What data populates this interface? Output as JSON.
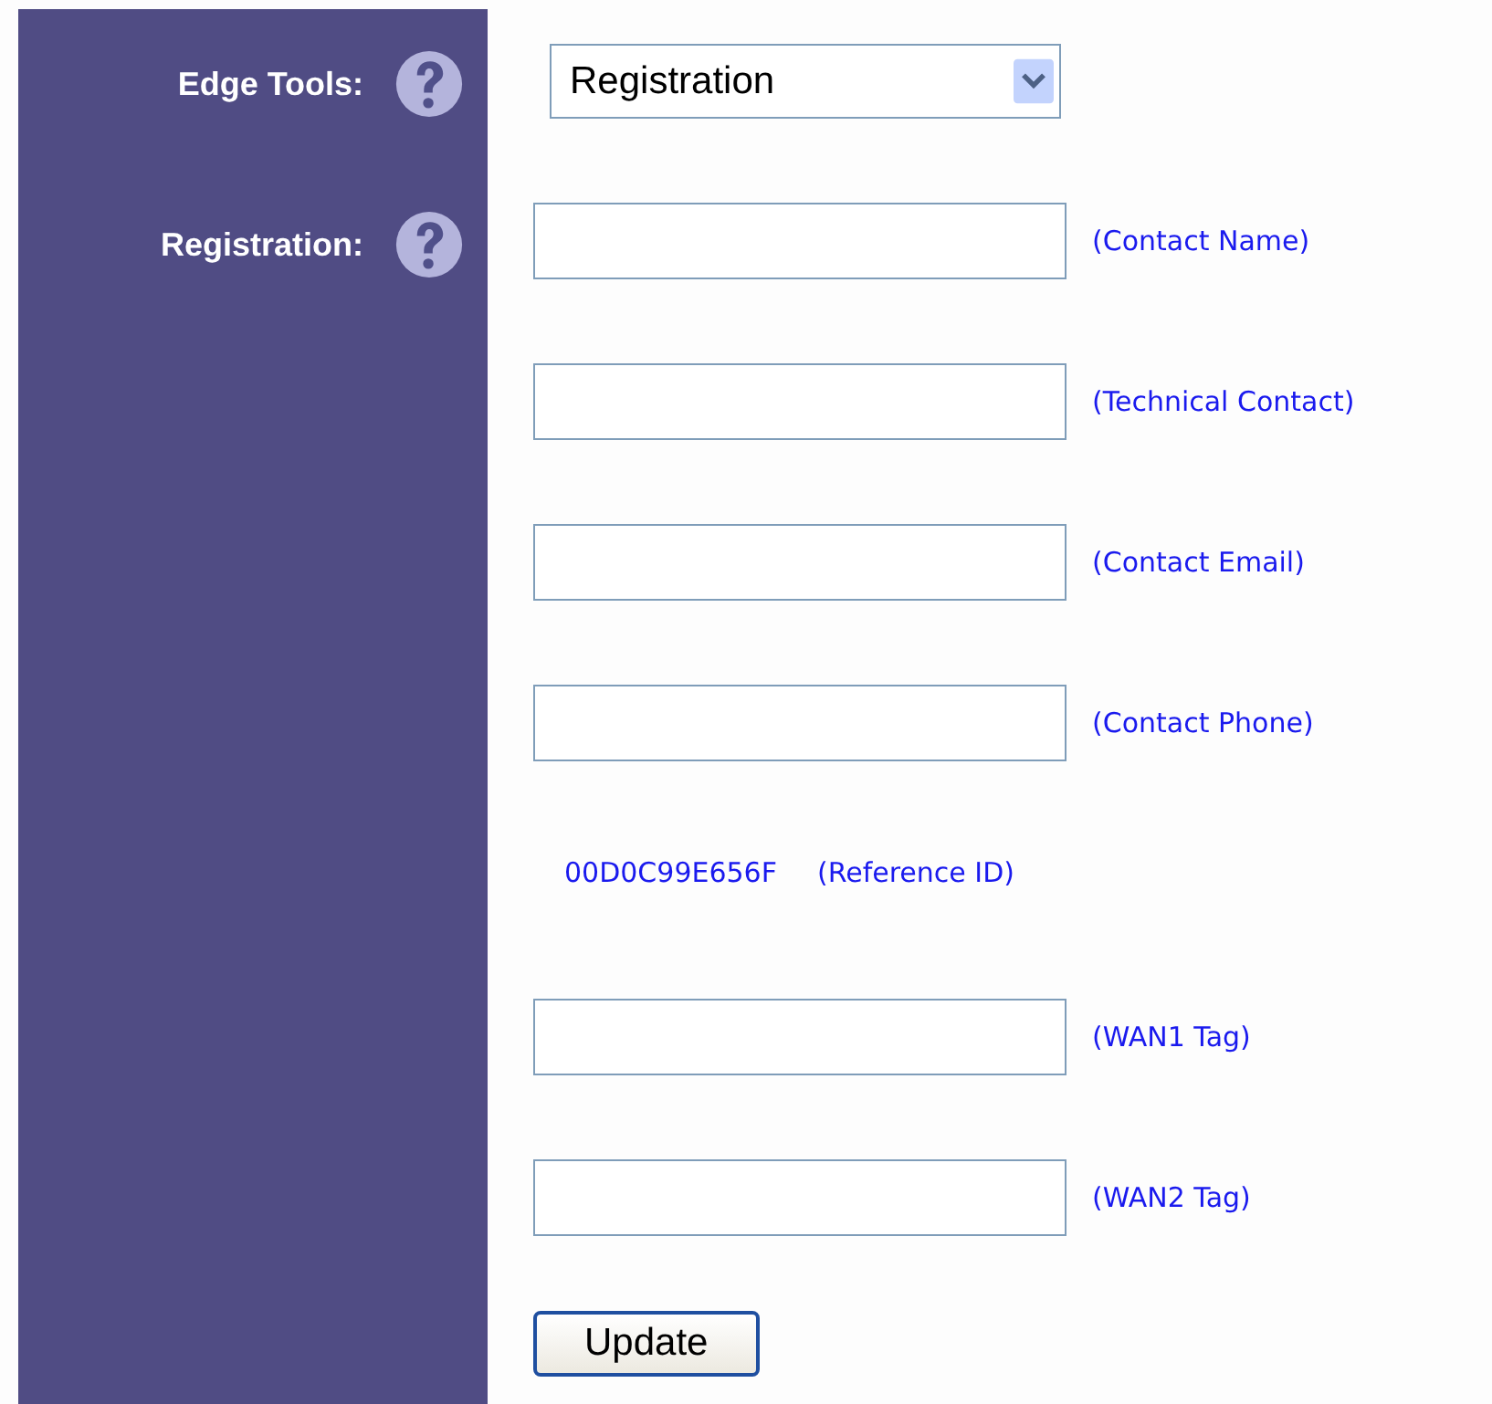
{
  "sidebar": {
    "items": [
      {
        "label": "Edge Tools:"
      },
      {
        "label": "Registration:"
      }
    ]
  },
  "tool_select": {
    "value": "Registration"
  },
  "rows": [
    {
      "kind": "input",
      "hint": "(Contact Name)"
    },
    {
      "kind": "input",
      "hint": "(Technical Contact)"
    },
    {
      "kind": "input",
      "hint": "(Contact Email)"
    },
    {
      "kind": "input",
      "hint": "(Contact Phone)"
    },
    {
      "kind": "reference",
      "value": "00D0C99E656F",
      "hint": "(Reference ID)"
    },
    {
      "kind": "input",
      "hint": "(WAN1 Tag)"
    },
    {
      "kind": "input",
      "hint": "(WAN2 Tag)"
    }
  ],
  "button": "Update"
}
